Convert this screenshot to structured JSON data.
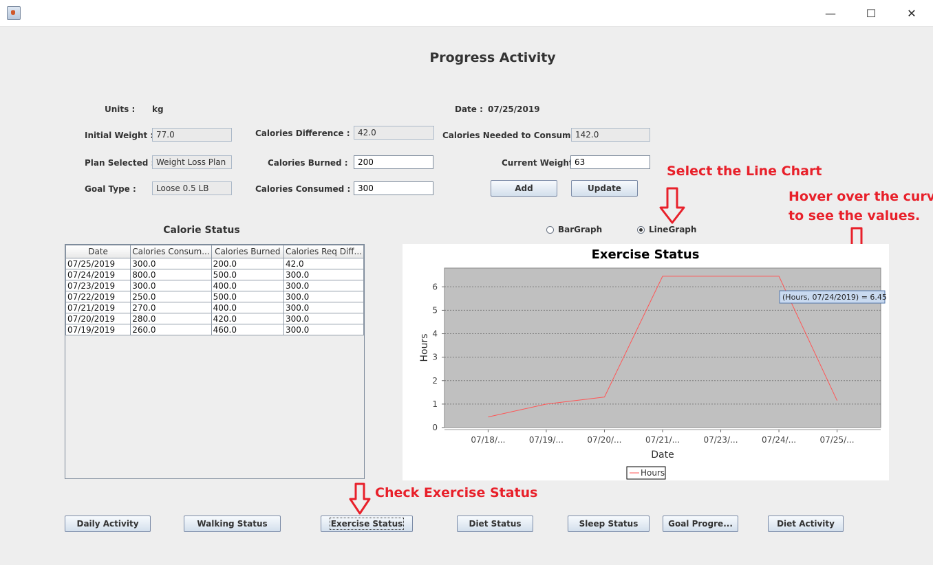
{
  "window": {
    "minimize_glyph": "—",
    "maximize_glyph": "☐",
    "close_glyph": "✕"
  },
  "page_title": "Progress Activity",
  "form": {
    "units_label": "Units :",
    "units_value": "kg",
    "date_label": "Date :",
    "date_value": "07/25/2019",
    "initial_weight_label": "Initial Weight :",
    "initial_weight_value": "77.0",
    "calories_difference_label": "Calories Difference :",
    "calories_difference_value": "42.0",
    "calories_needed_label": "Calories Needed to Consumed :",
    "calories_needed_value": "142.0",
    "plan_selected_label": "Plan Selected :",
    "plan_selected_value": "Weight Loss Plan",
    "calories_burned_label": "Calories Burned :",
    "calories_burned_value": "200",
    "current_weight_label": "Current Weight :",
    "current_weight_value": "63",
    "goal_type_label": "Goal Type :",
    "goal_type_value": "Loose 0.5 LB",
    "calories_consumed_label": "Calories Consumed :",
    "calories_consumed_value": "300",
    "add_label": "Add",
    "update_label": "Update"
  },
  "table": {
    "title": "Calorie Status",
    "columns": [
      "Date",
      "Calories Consum...",
      "Calories Burned",
      "Calories Req Diff..."
    ],
    "rows": [
      [
        "07/25/2019",
        "300.0",
        "200.0",
        "42.0"
      ],
      [
        "07/24/2019",
        "800.0",
        "500.0",
        "300.0"
      ],
      [
        "07/23/2019",
        "300.0",
        "400.0",
        "300.0"
      ],
      [
        "07/22/2019",
        "250.0",
        "500.0",
        "300.0"
      ],
      [
        "07/21/2019",
        "270.0",
        "400.0",
        "300.0"
      ],
      [
        "07/20/2019",
        "280.0",
        "420.0",
        "300.0"
      ],
      [
        "07/19/2019",
        "260.0",
        "460.0",
        "300.0"
      ]
    ]
  },
  "graph_options": {
    "bar_label": "BarGraph",
    "line_label": "LineGraph",
    "selected": "line"
  },
  "chart_data": {
    "type": "line",
    "title": "Exercise Status",
    "xlabel": "Date",
    "ylabel": "Hours",
    "categories": [
      "07/18/...",
      "07/19/...",
      "07/20/...",
      "07/21/...",
      "07/23/...",
      "07/24/...",
      "07/25/..."
    ],
    "series": [
      {
        "name": "Hours",
        "values": [
          0.45,
          1.0,
          1.3,
          6.45,
          6.45,
          6.45,
          1.15
        ],
        "color": "#ff5555"
      }
    ],
    "ylim": [
      0,
      6.8
    ],
    "yticks": [
      0,
      1,
      2,
      3,
      4,
      5,
      6
    ],
    "grid": true,
    "legend": "bottom",
    "plot_background": "#c0c0c0",
    "tooltip": "(Hours, 07/24/2019) = 6.45"
  },
  "annotations": {
    "select_line_chart": "Select the Line Chart",
    "hover_line1": "Hover over the curves",
    "hover_line2": "to see the values.",
    "check_exercise": "Check Exercise Status",
    "color": "#e8202a"
  },
  "nav_buttons": {
    "daily_activity": "Daily Activity",
    "walking_status": "Walking Status",
    "exercise_status": "Exercise Status",
    "diet_status": "Diet Status",
    "sleep_status": "Sleep Status",
    "goal_progress": "Goal Progre...",
    "diet_activity": "Diet Activity"
  }
}
